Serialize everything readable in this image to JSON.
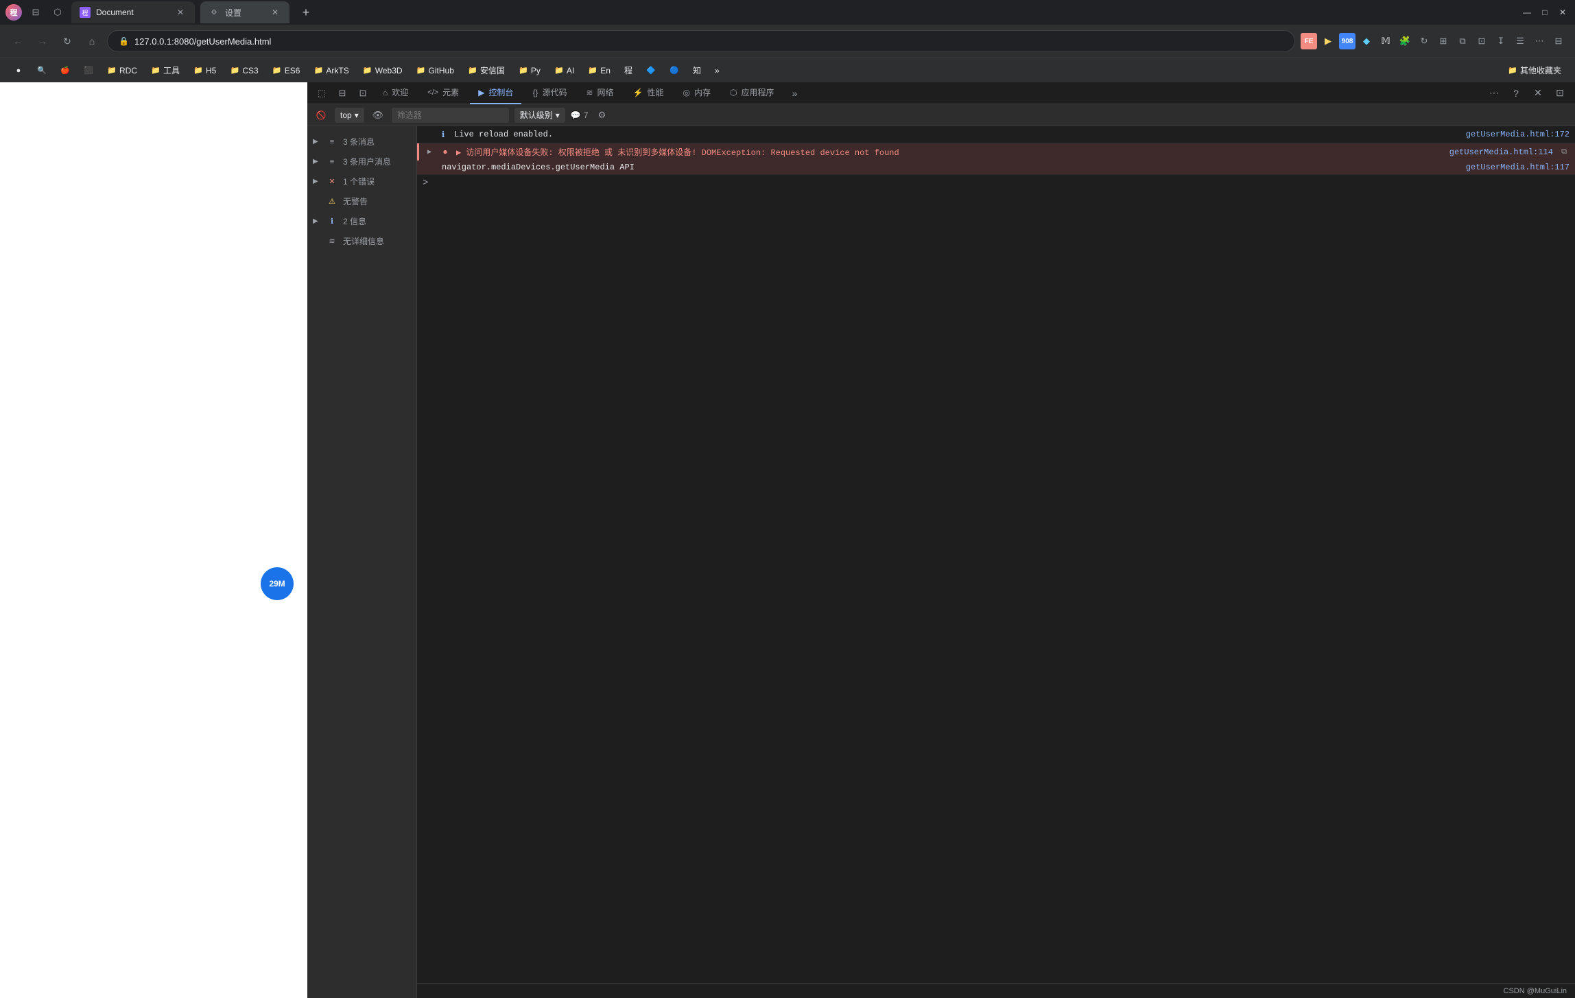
{
  "window": {
    "title": "程 Document",
    "minimize": "—",
    "maximize": "□",
    "close": "✕"
  },
  "tabs": [
    {
      "id": "document",
      "label": "Document",
      "favicon": "程",
      "active": true
    },
    {
      "id": "settings",
      "label": "设置",
      "favicon": "⚙",
      "active": false
    }
  ],
  "tab_new": "+",
  "address_bar": {
    "url": "127.0.0.1:8080/getUserMedia.html",
    "back": "←",
    "forward": "→",
    "refresh": "↻",
    "home": "⌂"
  },
  "bookmarks": [
    {
      "label": "",
      "icon": "●",
      "type": "icon-only"
    },
    {
      "label": "",
      "icon": "🔍",
      "type": "icon-only"
    },
    {
      "label": "",
      "icon": "🍎",
      "type": "icon-only"
    },
    {
      "label": "",
      "icon": "●",
      "type": "icon-only"
    },
    {
      "label": "RDC",
      "icon": "📁"
    },
    {
      "label": "工具",
      "icon": "📁"
    },
    {
      "label": "H5",
      "icon": "📁"
    },
    {
      "label": "CS3",
      "icon": "📁"
    },
    {
      "label": "ES6",
      "icon": "📁"
    },
    {
      "label": "ArkTS",
      "icon": "📁"
    },
    {
      "label": "Web3D",
      "icon": "📁"
    },
    {
      "label": "GitHub",
      "icon": "📁"
    },
    {
      "label": "安信国",
      "icon": "📁"
    },
    {
      "label": "Py",
      "icon": "📁"
    },
    {
      "label": "AI",
      "icon": "📁"
    },
    {
      "label": "En",
      "icon": "📁"
    },
    {
      "label": "程",
      "icon": "📄"
    },
    {
      "label": "知",
      "icon": "📄"
    },
    {
      "label": "其他收藏夹",
      "icon": "📁"
    }
  ],
  "viewport": {
    "background": "#ffffff",
    "badge": {
      "text": "29M",
      "color": "#1a73e8"
    }
  },
  "devtools": {
    "tabs": [
      {
        "id": "elements",
        "label": "元素",
        "icon": "⟨/⟩",
        "active": false
      },
      {
        "id": "console",
        "label": "控制台",
        "icon": "▶",
        "active": true
      },
      {
        "id": "sources",
        "label": "源代码",
        "icon": "{ }",
        "active": false
      },
      {
        "id": "network",
        "label": "网络",
        "icon": "≋",
        "active": false
      },
      {
        "id": "performance",
        "label": "性能",
        "icon": "⚡",
        "active": false
      },
      {
        "id": "memory",
        "label": "内存",
        "icon": "◎",
        "active": false
      },
      {
        "id": "application",
        "label": "应用程序",
        "icon": "⬡",
        "active": false
      }
    ],
    "outer_toolbar": {
      "inspect": "⬚",
      "device": "⊟",
      "more": "⋯",
      "help": "?",
      "close": "✕",
      "dock": "⊡"
    },
    "secondary_toolbar": {
      "clear": "🚫",
      "top_label": "top",
      "eye_label": "👁",
      "filter_placeholder": "筛选器",
      "level_label": "默认级别",
      "chevron": "▾",
      "badge_count": "7",
      "settings_icon": "⚙"
    },
    "sidebar": {
      "items": [
        {
          "id": "messages",
          "label": "3 条消息",
          "badge": "3",
          "badge_type": "neutral",
          "icon": "≡",
          "expand": "▶"
        },
        {
          "id": "user_messages",
          "label": "3 条用户消息",
          "badge": "3",
          "badge_type": "neutral",
          "icon": "≡",
          "expand": "▶"
        },
        {
          "id": "errors",
          "label": "1 个错误",
          "badge": "1",
          "badge_type": "error",
          "icon": "✕",
          "expand": "▶"
        },
        {
          "id": "warnings",
          "label": "无警告",
          "badge": "",
          "badge_type": "none",
          "icon": "⚠",
          "expand": ""
        },
        {
          "id": "info",
          "label": "2 信息",
          "badge": "2",
          "badge_type": "info",
          "icon": "ℹ",
          "expand": "▶"
        },
        {
          "id": "verbose",
          "label": "无详细信息",
          "badge": "",
          "badge_type": "none",
          "icon": "≋",
          "expand": ""
        }
      ]
    },
    "console_messages": [
      {
        "id": "msg1",
        "type": "info",
        "text": "Live reload enabled.",
        "location": "getUserMedia.html:172",
        "expand": false,
        "has_expand": false
      },
      {
        "id": "msg2",
        "type": "error",
        "text": "▶ 访问用户媒体设备失败: 权限被拒绝 或 未识别到多媒体设备! DOMException: Requested device not found",
        "location": "getUserMedia.html:114",
        "expand": false,
        "has_expand": true,
        "sub_text": "navigator.mediaDevices.getUserMedia API",
        "sub_location": "getUserMedia.html:117"
      }
    ],
    "prompt": ">"
  },
  "status_bar": {
    "text": "CSDN @MuGuiLin"
  }
}
